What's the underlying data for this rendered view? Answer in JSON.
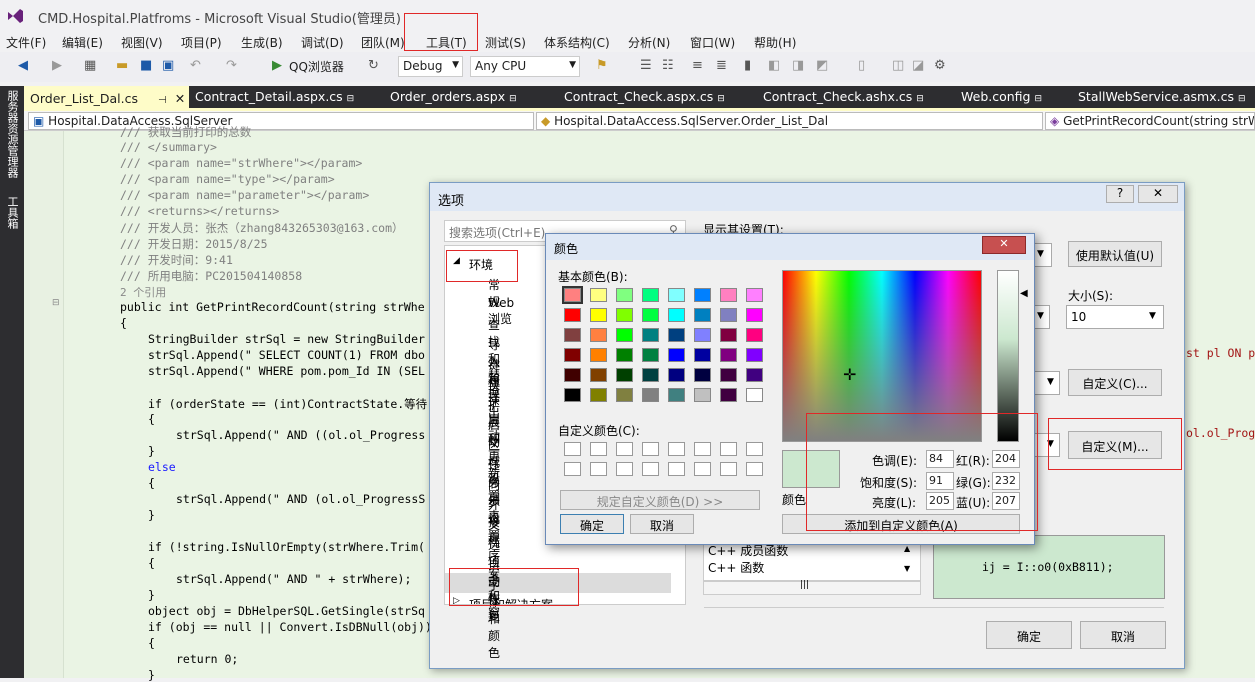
{
  "window": {
    "title": "CMD.Hospital.Platfroms - Microsoft Visual Studio(管理员)"
  },
  "menu": [
    "文件(F)",
    "编辑(E)",
    "视图(V)",
    "项目(P)",
    "生成(B)",
    "调试(D)",
    "团队(M)",
    "工具(T)",
    "测试(S)",
    "体系结构(C)",
    "分析(N)",
    "窗口(W)",
    "帮助(H)"
  ],
  "toolbar": {
    "browser_label": "QQ浏览器",
    "config": "Debug",
    "platform": "Any CPU"
  },
  "side_strip": {
    "label1": "服务器资源管理器",
    "label2": "工具箱"
  },
  "tabs": [
    "Order_List_Dal.cs",
    "Contract_Detail.aspx.cs",
    "Order_orders.aspx",
    "Contract_Check.aspx.cs",
    "Contract_Check.ashx.cs",
    "Web.config",
    "StallWebService.asmx.cs"
  ],
  "navbar": {
    "namespace": "Hospital.DataAccess.SqlServer",
    "class": "Hospital.DataAccess.SqlServer.Order_List_Dal",
    "member": "GetPrintRecordCount(string strW"
  },
  "code": [
    "/// 获取当前打印的总数",
    "/// </summary>",
    "/// <param name=\"strWhere\"></param>",
    "/// <param name=\"type\"></param>",
    "/// <param name=\"parameter\"></param>",
    "/// <returns></returns>",
    "/// 开发人员：张杰（zhang843265303@163.com）",
    "/// 开发日期：2015/8/25",
    "/// 开发时间：9:41",
    "/// 所用电脑：PC201504140858",
    "2 个引用",
    "public int GetPrintRecordCount(string strWhe",
    "{",
    "StringBuilder strSql = new StringBuilder",
    "strSql.Append(\" SELECT COUNT(1) FROM dbo",
    "strSql.Append(\" WHERE pom.pom_Id IN (SEL",
    "",
    "if (orderState == (int)ContractState.等待",
    "{",
    "strSql.Append(\" AND ((ol.ol_Progress",
    "}",
    "else",
    "{",
    "strSql.Append(\" AND (ol.ol_ProgressS",
    "}",
    "",
    "if (!string.IsNullOrEmpty(strWhere.Trim(",
    "{",
    "strSql.Append(\" AND \" + strWhere);",
    "}",
    "object obj = DbHelperSQL.GetSingle(strSq",
    "if (obj == null || Convert.IsDBNull(obj))",
    "{",
    "return 0;",
    "}"
  ],
  "code_right": {
    "line1": "st pl ON p",
    "line2": "ol.ol_Progres"
  },
  "options_dialog": {
    "title": "选项",
    "search_placeholder": "搜索选项(Ctrl+E)",
    "tree_root": "环境",
    "tree_items": [
      "常规",
      "Web 浏览",
      "查找和替换",
      "导入和导出",
      "键盘",
      "快速启动",
      "扩展和更新",
      "启动",
      "区域设置",
      "任务列表",
      "同步设置",
      "外接程序安",
      "文档",
      "选项卡和窗",
      "自动恢复",
      "字体和颜色"
    ],
    "tree_next": "项目和解决方案",
    "show_settings_label": "显示其设置(T):",
    "use_defaults": "使用默认值(U)",
    "size_label": "大小(S):",
    "size_value": "10",
    "custom_c": "自定义(C)...",
    "custom_m": "自定义(M)...",
    "list_items": [
      "C++ 成员函数",
      "C++ 函数"
    ],
    "preview_text": "ij = I::o0(0xB811);",
    "ok": "确定",
    "cancel": "取消"
  },
  "color_dialog": {
    "title": "颜色",
    "basic_label": "基本颜色(B):",
    "custom_label": "自定义颜色(C):",
    "define_custom": "规定自定义颜色(D) >>",
    "ok": "确定",
    "cancel": "取消",
    "color_label": "颜色",
    "hue_label": "色调(E):",
    "hue": "84",
    "sat_label": "饱和度(S):",
    "sat": "91",
    "lum_label": "亮度(L):",
    "lum": "205",
    "red_label": "红(R):",
    "red": "204",
    "green_label": "绿(G):",
    "green": "232",
    "blue_label": "蓝(U):",
    "blue": "207",
    "add_custom": "添加到自定义颜色(A)",
    "basic_colors": [
      "#ff8080",
      "#ffff80",
      "#80ff80",
      "#00ff80",
      "#80ffff",
      "#0080ff",
      "#ff80c0",
      "#ff80ff",
      "#ff0000",
      "#ffff00",
      "#80ff00",
      "#00ff40",
      "#00ffff",
      "#0080c0",
      "#8080c0",
      "#ff00ff",
      "#804040",
      "#ff8040",
      "#00ff00",
      "#008080",
      "#004080",
      "#8080ff",
      "#800040",
      "#ff0080",
      "#800000",
      "#ff8000",
      "#008000",
      "#008040",
      "#0000ff",
      "#0000a0",
      "#800080",
      "#8000ff",
      "#400000",
      "#804000",
      "#004000",
      "#004040",
      "#000080",
      "#000040",
      "#400040",
      "#400080",
      "#000000",
      "#808000",
      "#808040",
      "#808080",
      "#408080",
      "#c0c0c0",
      "#400040",
      "#ffffff"
    ],
    "preview_color": "#cce8cf"
  }
}
